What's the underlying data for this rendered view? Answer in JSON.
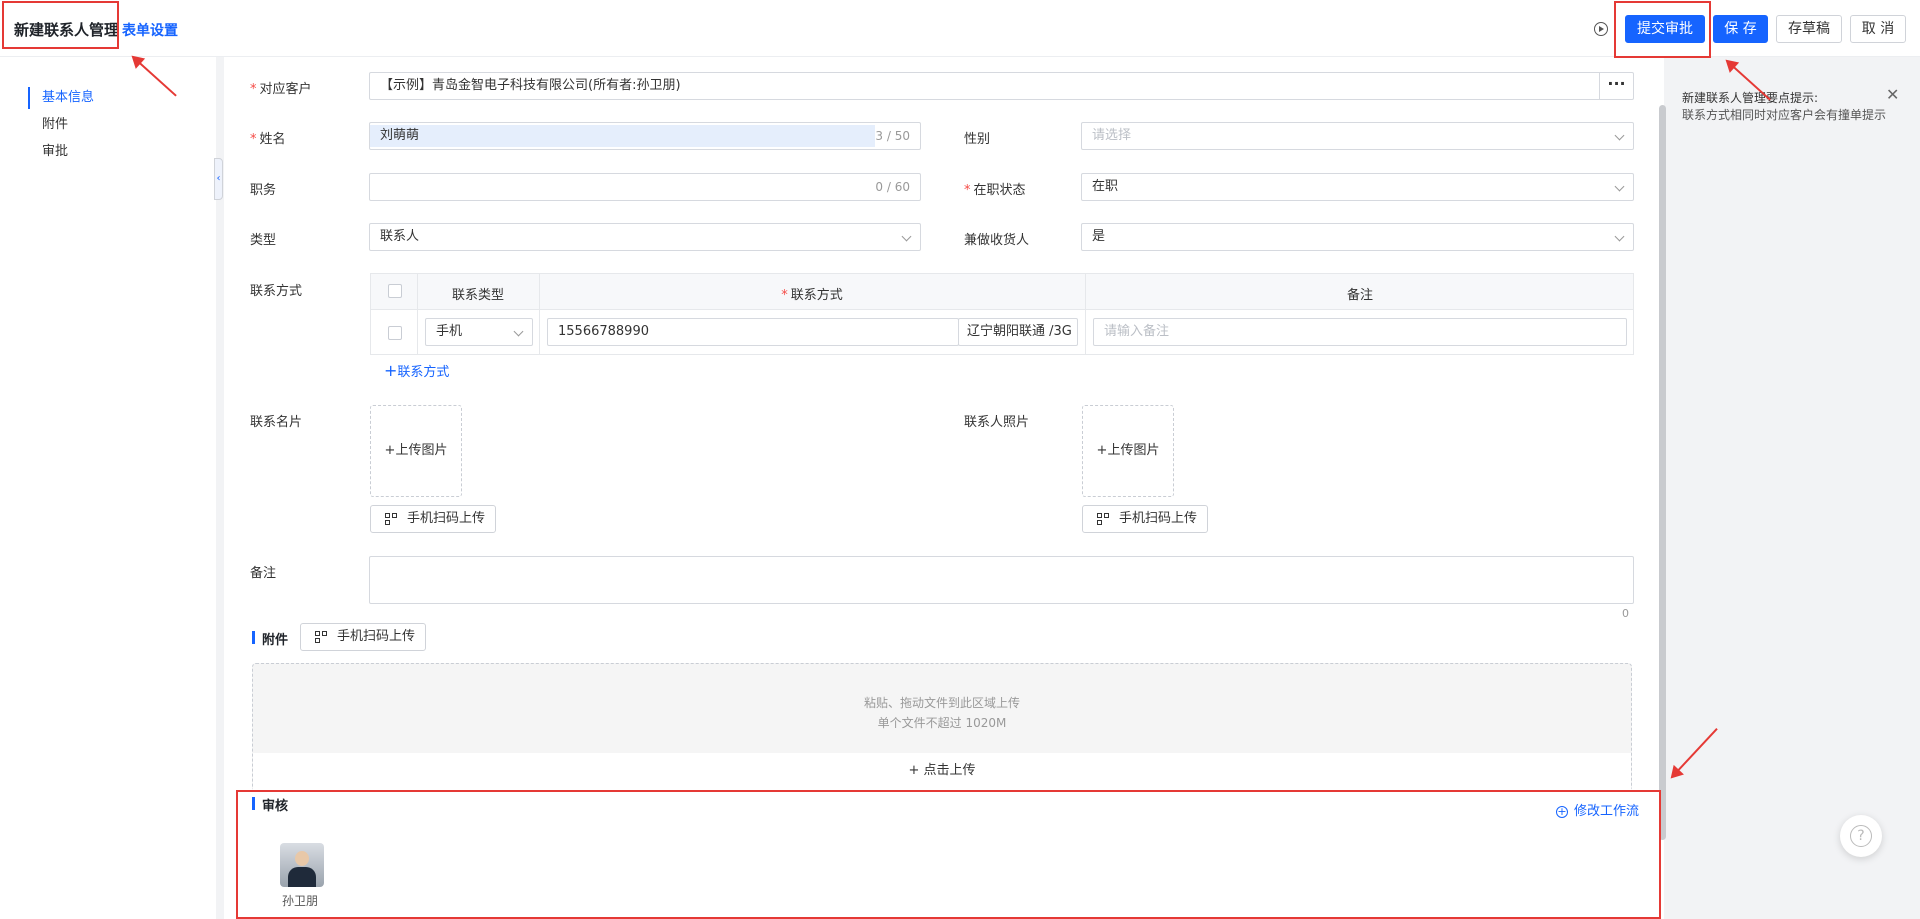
{
  "header": {
    "title": "新建联系人管理",
    "form_settings": "表单设置",
    "submit_approval": "提交审批",
    "save": "保 存",
    "save_draft": "存草稿",
    "cancel": "取 消"
  },
  "sidebar": {
    "items": [
      {
        "label": "基本信息"
      },
      {
        "label": "附件"
      },
      {
        "label": "审批"
      }
    ],
    "collapse_glyph": "‹"
  },
  "form": {
    "customer": {
      "label": "对应客户",
      "required": "*",
      "value": "【示例】青岛金智电子科技有限公司(所有者:孙卫朋)",
      "more": "···"
    },
    "name": {
      "label": "姓名",
      "required": "*",
      "value": "刘萌萌",
      "count": "3 / 50"
    },
    "gender": {
      "label": "性别",
      "placeholder": "请选择"
    },
    "position": {
      "label": "职务",
      "value": "",
      "count": "0 / 60"
    },
    "employment": {
      "label": "在职状态",
      "required": "*",
      "value": "在职"
    },
    "type": {
      "label": "类型",
      "value": "联系人"
    },
    "consignee": {
      "label": "兼做收货人",
      "value": "是"
    },
    "contact": {
      "label": "联系方式",
      "columns": [
        "联系类型",
        "联系方式",
        "备注"
      ],
      "required": "*",
      "rows": [
        {
          "type": "手机",
          "value": "15566788990",
          "carrier": "辽宁朝阳联通 /3G",
          "remark_placeholder": "请输入备注"
        }
      ],
      "add_label": "联系方式",
      "add_plus": "+"
    },
    "business_card": {
      "label": "联系名片",
      "upload": "+上传图片",
      "scan": "手机扫码上传"
    },
    "photo": {
      "label": "联系人照片",
      "upload": "+上传图片",
      "scan": "手机扫码上传"
    },
    "remark": {
      "label": "备注",
      "count": "0"
    }
  },
  "attachment": {
    "title": "附件",
    "scan": "手机扫码上传",
    "drop_line1": "粘贴、拖动文件到此区域上传",
    "drop_line2": "单个文件不超过 1020M",
    "click_upload": "+ 点击上传"
  },
  "approval": {
    "title": "审核",
    "modify_workflow": "修改工作流",
    "approver": "孙卫朋"
  },
  "tip": {
    "title": "新建联系人管理要点提示:",
    "body": "联系方式相同时对应客户会有撞单提示",
    "close": "✕"
  },
  "help": "?",
  "colors": {
    "accent": "#1664ff",
    "required": "#f54a45",
    "annotation": "#e53935"
  }
}
